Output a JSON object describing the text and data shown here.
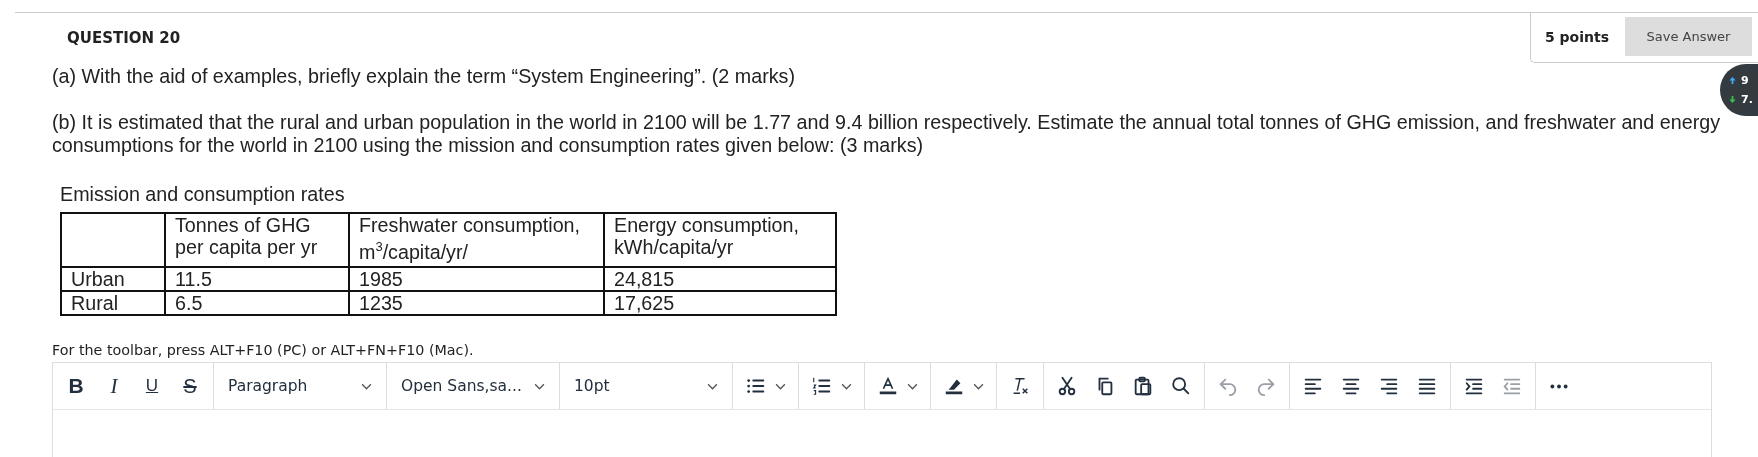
{
  "question": {
    "title": "QUESTION 20",
    "points": "5 points",
    "save_button": "Save Answer"
  },
  "speed_widget": {
    "upload": "9",
    "download": "7."
  },
  "paragraphs": [
    "(a) With the aid of examples, briefly explain the term “System Engineering”. (2 marks)",
    "(b) It is estimated that the rural and urban population in the world in 2100 will be 1.77 and 9.4 billion respectively. Estimate the annual total tonnes of GHG emission, and freshwater and energy consumptions for the world in 2100 using the mission and consumption rates given below: (3 marks)"
  ],
  "table": {
    "caption": "Emission and consumption rates",
    "columns": [
      "",
      "Tonnes of GHG per capita per yr",
      "Freshwater consumption, m$^{3}$/capita/yr/",
      "Energy consumption, kWh/capita/yr"
    ],
    "rows": [
      [
        "Urban",
        "11.5",
        "1985",
        "24,815"
      ],
      [
        "Rural",
        "6.5",
        "1235",
        "17,625"
      ]
    ]
  },
  "editor": {
    "hint": "For the toolbar, press ALT+F10 (PC) or ALT+FN+F10 (Mac).",
    "toolbar": [
      [
        {
          "kind": "bold",
          "label": "B",
          "disabled": false
        },
        {
          "kind": "italic",
          "label": "I",
          "disabled": false
        },
        {
          "kind": "underline",
          "label": "U",
          "disabled": false
        },
        {
          "kind": "strikethrough",
          "label": "S",
          "disabled": false
        }
      ],
      [
        {
          "kind": "select",
          "label": "Paragraph",
          "disabled": false
        }
      ],
      [
        {
          "kind": "select",
          "label": "Open Sans,sa...",
          "disabled": false
        }
      ],
      [
        {
          "kind": "select",
          "label": "10pt",
          "disabled": false
        }
      ],
      [
        {
          "kind": "bullets",
          "disabled": false
        }
      ],
      [
        {
          "kind": "numbering",
          "disabled": false
        }
      ],
      [
        {
          "kind": "textcolor",
          "disabled": false
        }
      ],
      [
        {
          "kind": "highlight",
          "disabled": false
        }
      ],
      [
        {
          "kind": "clearformat",
          "disabled": false
        }
      ],
      [
        {
          "kind": "cut",
          "disabled": false
        },
        {
          "kind": "copy",
          "disabled": false
        },
        {
          "kind": "paste",
          "disabled": false
        },
        {
          "kind": "search",
          "disabled": false
        }
      ],
      [
        {
          "kind": "undo",
          "disabled": true
        },
        {
          "kind": "redo",
          "disabled": true
        }
      ],
      [
        {
          "kind": "alignleft",
          "disabled": false
        },
        {
          "kind": "aligncenter",
          "disabled": false
        },
        {
          "kind": "alignright",
          "disabled": false
        },
        {
          "kind": "justify",
          "disabled": false
        }
      ],
      [
        {
          "kind": "indent",
          "disabled": false
        },
        {
          "kind": "outdent",
          "disabled": true
        }
      ],
      [
        {
          "kind": "more",
          "disabled": false
        }
      ]
    ]
  }
}
